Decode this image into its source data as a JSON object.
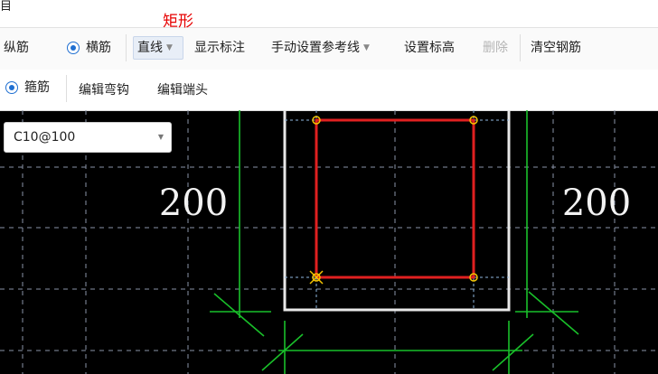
{
  "window": {
    "corner_text": "目"
  },
  "annotation": "矩形",
  "toolbar1": {
    "longitudinal": "纵筋",
    "transverse": "横筋",
    "line_mode": "直线",
    "show_dims": "显示标注",
    "manual_ref": "手动设置参考线",
    "set_elev": "设置标高",
    "delete": "删除",
    "clear_rebar": "清空钢筋"
  },
  "toolbar2": {
    "stirrup": "箍筋",
    "edit_hook": "编辑弯钩",
    "edit_end": "编辑端头"
  },
  "spec_select": {
    "value": "C10@100"
  },
  "drawing": {
    "dim_left": "200",
    "dim_right": "200",
    "colors": {
      "grid": "#8a93a8",
      "dimension": "#19c02a",
      "section": "#e8e8e8",
      "stirrup": "#e02020",
      "snap": "#f5c400"
    }
  }
}
